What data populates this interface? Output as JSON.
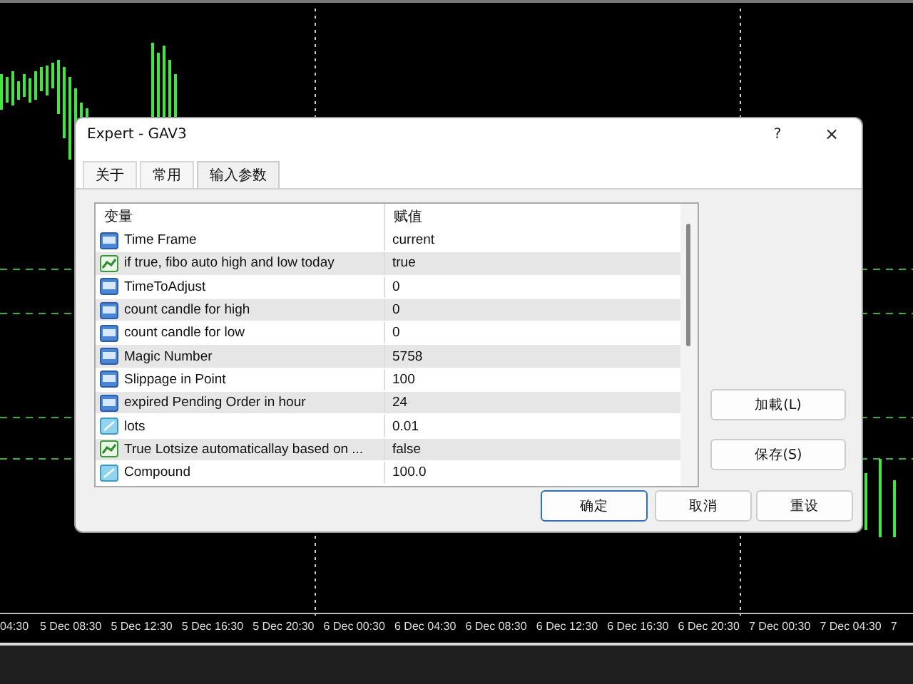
{
  "chart": {
    "time_axis": [
      "04:30",
      "5 Dec 08:30",
      "5 Dec 12:30",
      "5 Dec 16:30",
      "5 Dec 20:30",
      "6 Dec 00:30",
      "6 Dec 04:30",
      "6 Dec 08:30",
      "6 Dec 12:30",
      "6 Dec 16:30",
      "6 Dec 20:30",
      "7 Dec 00:30",
      "7 Dec 04:30",
      "7"
    ]
  },
  "window": {
    "title": "Expert - GAV3",
    "help": "?",
    "close": "×"
  },
  "tabs": [
    {
      "label": "关于",
      "selected": false
    },
    {
      "label": "常用",
      "selected": false
    },
    {
      "label": "输入参数",
      "selected": true
    }
  ],
  "table": {
    "columns": [
      "变量",
      "赋值"
    ],
    "rows": [
      {
        "kind": "int",
        "name": "Time Frame",
        "value": "current"
      },
      {
        "kind": "bool",
        "name": "if true, fibo auto high and low today",
        "value": "true"
      },
      {
        "kind": "int",
        "name": "TimeToAdjust",
        "value": "0"
      },
      {
        "kind": "int",
        "name": "count candle for high",
        "value": "0"
      },
      {
        "kind": "int",
        "name": "count candle for low",
        "value": "0"
      },
      {
        "kind": "int",
        "name": "Magic Number",
        "value": "5758"
      },
      {
        "kind": "int",
        "name": "Slippage in Point",
        "value": "100"
      },
      {
        "kind": "int",
        "name": "expired Pending Order in hour",
        "value": "24"
      },
      {
        "kind": "double",
        "name": "lots",
        "value": "0.01"
      },
      {
        "kind": "bool",
        "name": "True Lotsize automaticallay based on ...",
        "value": "false"
      },
      {
        "kind": "double",
        "name": "Compound",
        "value": "100.0"
      }
    ]
  },
  "side_buttons": [
    "加載(L)",
    "保存(S)"
  ],
  "buttons": [
    {
      "label": "确定",
      "default": true
    },
    {
      "label": "取消",
      "default": false
    },
    {
      "label": "重设",
      "default": false
    }
  ]
}
